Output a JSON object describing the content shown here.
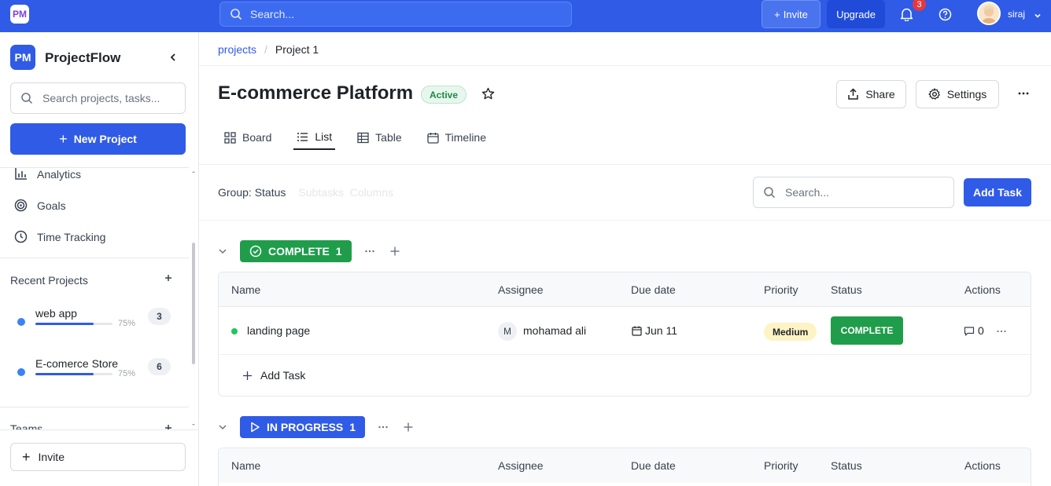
{
  "topbar": {
    "logo": "PM",
    "search_placeholder": "Search...",
    "invite_label": "Invite",
    "upgrade_label": "Upgrade",
    "notification_count": "3",
    "user_name": "siraj"
  },
  "sidebar": {
    "brand_badge": "PM",
    "brand_name": "ProjectFlow",
    "search_placeholder": "Search projects, tasks...",
    "new_project_label": "New Project",
    "nav": [
      {
        "label": "Analytics",
        "icon": "analytics-icon"
      },
      {
        "label": "Goals",
        "icon": "goals-icon"
      },
      {
        "label": "Time Tracking",
        "icon": "clock-icon"
      }
    ],
    "recent_projects_title": "Recent Projects",
    "projects": [
      {
        "name": "web app",
        "progress": 75,
        "progress_label": "75%",
        "count": "3"
      },
      {
        "name": "E-comerce Store",
        "progress": 75,
        "progress_label": "75%",
        "count": "6"
      }
    ],
    "teams_title": "Teams",
    "invite_label": "Invite"
  },
  "main": {
    "breadcrumb": {
      "parent": "projects",
      "separator": "/",
      "current": "Project 1"
    },
    "title": "E-commerce Platform",
    "status": "Active",
    "share_label": "Share",
    "settings_label": "Settings",
    "tabs": [
      {
        "label": "Board",
        "icon": "grid-icon"
      },
      {
        "label": "List",
        "icon": "list-icon",
        "active": true
      },
      {
        "label": "Table",
        "icon": "table-icon"
      },
      {
        "label": "Timeline",
        "icon": "calendar-icon"
      }
    ],
    "toolbar": {
      "group_label": "Group: Status",
      "subtasks_label": "Subtasks",
      "columns_label": "Columns",
      "search_placeholder": "Search...",
      "add_task_label": "Add Task"
    },
    "groups": [
      {
        "name": "COMPLETE",
        "count": "1",
        "columns": [
          "Name",
          "Assignee",
          "Due date",
          "Priority",
          "Status",
          "Actions"
        ],
        "tasks": [
          {
            "name": "landing page",
            "assignee_initial": "M",
            "assignee": "mohamad ali",
            "due": "Jun 11",
            "priority": "Medium",
            "status": "COMPLETE",
            "comments": "0"
          }
        ],
        "add_task_label": "Add Task"
      },
      {
        "name": "IN PROGRESS",
        "count": "1",
        "columns": [
          "Name",
          "Assignee",
          "Due date",
          "Priority",
          "Status",
          "Actions"
        ]
      }
    ]
  },
  "colors": {
    "primary": "#2f5be6",
    "complete": "#1f9d4b",
    "priority_medium": "#fdf3c4",
    "active_pill": "#e8f7ee"
  }
}
